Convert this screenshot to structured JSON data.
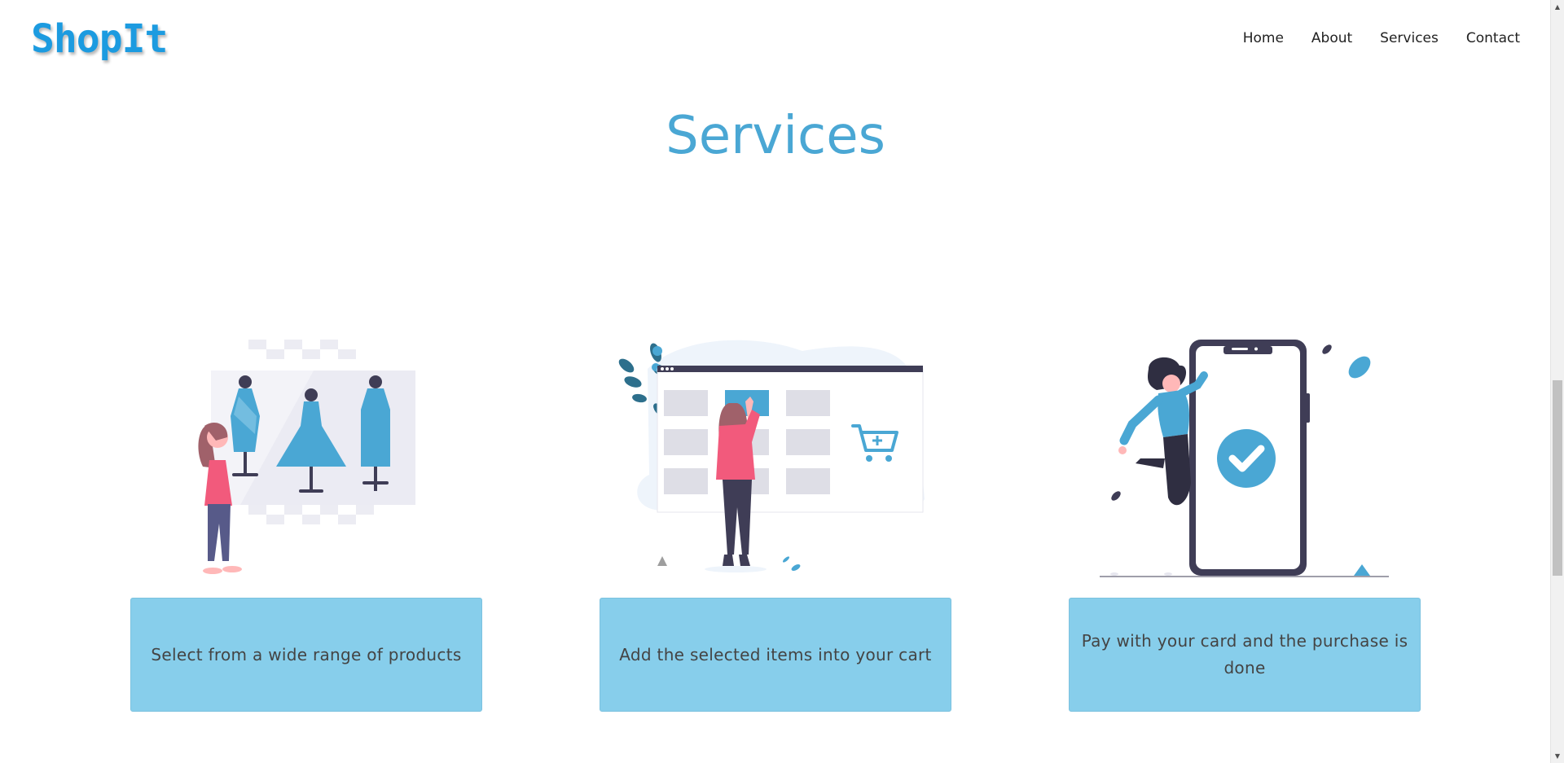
{
  "header": {
    "logo": "ShopIt",
    "nav": [
      "Home",
      "About",
      "Services",
      "Contact"
    ]
  },
  "services": {
    "title": "Services",
    "cards": [
      {
        "illustration": "mannequins-shopping-illustration",
        "text": "Select from a wide range of products"
      },
      {
        "illustration": "add-to-cart-illustration",
        "text": "Add the selected items into your cart"
      },
      {
        "illustration": "phone-payment-success-illustration",
        "text": "Pay with your card and the purchase is done"
      }
    ]
  },
  "colors": {
    "brand": "#1c9be0",
    "title": "#4aa7d4",
    "card_bg": "#87ceeb",
    "illustration_blue": "#4aa7d4",
    "illustration_pink": "#f25a7c",
    "illustration_dark": "#3f3d56"
  },
  "scrollbar": {
    "position": 0.42
  }
}
